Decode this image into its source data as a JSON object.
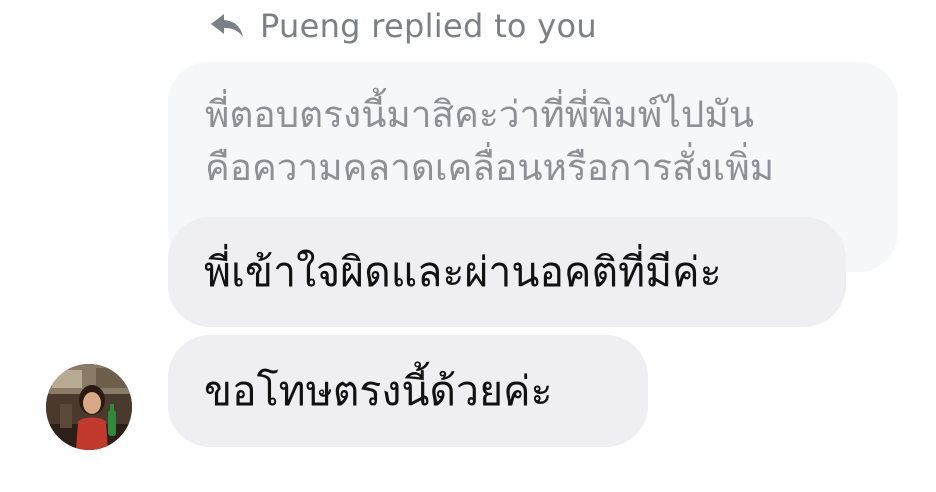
{
  "reply_header": {
    "icon": "reply-arrow-icon",
    "text": "Pueng replied to you"
  },
  "quoted_message": {
    "line1": "พี่ตอบตรงนี้มาสิคะว่าที่พี่พิมพ์ไปมัน",
    "line2": "คือความคลาดเคลื่อนหรือการสั่งเพิ่ม"
  },
  "messages": [
    {
      "text": "พี่เข้าใจผิดและผ่านอคติที่มีค่ะ"
    },
    {
      "text": "ขอโทษตรงนี้ด้วยค่ะ"
    }
  ],
  "avatar": {
    "icon": "user-avatar"
  },
  "colors": {
    "header_text": "#7c7f85",
    "quoted_bubble": "#f6f7f9",
    "quoted_text": "#8d9096",
    "bubble": "#efeff3",
    "message_text": "#111111"
  }
}
